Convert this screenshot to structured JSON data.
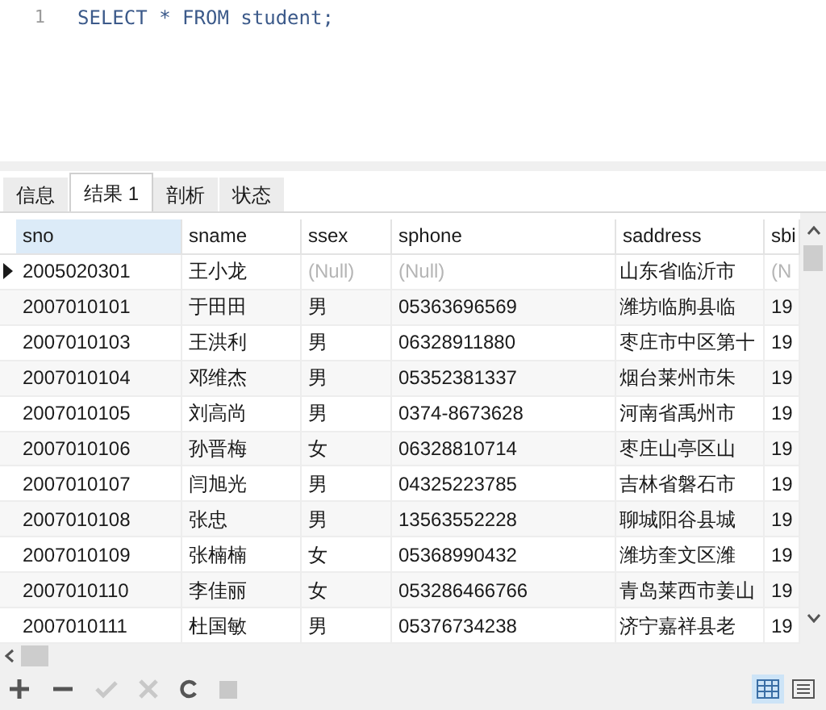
{
  "editor": {
    "lines": [
      {
        "number": "1",
        "code": "SELECT * FROM student;"
      }
    ]
  },
  "tabs": [
    {
      "label": "信息",
      "selected": false
    },
    {
      "label": "结果 1",
      "selected": true
    },
    {
      "label": "剖析",
      "selected": false
    },
    {
      "label": "状态",
      "selected": false
    }
  ],
  "table": {
    "columns": [
      {
        "label": "sno",
        "selected": true
      },
      {
        "label": "sname",
        "selected": false
      },
      {
        "label": "ssex",
        "selected": false
      },
      {
        "label": "sphone",
        "selected": false
      },
      {
        "label": "saddress",
        "selected": false
      },
      {
        "label": "sbi",
        "selected": false
      }
    ],
    "rows": [
      {
        "selected": true,
        "cells": [
          {
            "text": "2005020301",
            "null": false
          },
          {
            "text": "王小龙",
            "null": false
          },
          {
            "text": "(Null)",
            "null": true
          },
          {
            "text": "(Null)",
            "null": true
          },
          {
            "text": "山东省临沂市",
            "null": false
          },
          {
            "text": "(N",
            "null": true
          }
        ]
      },
      {
        "selected": false,
        "cells": [
          {
            "text": "2007010101",
            "null": false
          },
          {
            "text": "于田田",
            "null": false
          },
          {
            "text": "男",
            "null": false
          },
          {
            "text": "05363696569",
            "null": false
          },
          {
            "text": "潍坊临朐县临",
            "null": false
          },
          {
            "text": "19",
            "null": false
          }
        ]
      },
      {
        "selected": false,
        "cells": [
          {
            "text": "2007010103",
            "null": false
          },
          {
            "text": "王洪利",
            "null": false
          },
          {
            "text": "男",
            "null": false
          },
          {
            "text": "06328911880",
            "null": false
          },
          {
            "text": "枣庄市中区第十",
            "null": false
          },
          {
            "text": "19",
            "null": false
          }
        ]
      },
      {
        "selected": false,
        "cells": [
          {
            "text": "2007010104",
            "null": false
          },
          {
            "text": "邓维杰",
            "null": false
          },
          {
            "text": "男",
            "null": false
          },
          {
            "text": "05352381337",
            "null": false
          },
          {
            "text": "烟台莱州市朱",
            "null": false
          },
          {
            "text": "19",
            "null": false
          }
        ]
      },
      {
        "selected": false,
        "cells": [
          {
            "text": "2007010105",
            "null": false
          },
          {
            "text": "刘高尚",
            "null": false
          },
          {
            "text": "男",
            "null": false
          },
          {
            "text": "0374-8673628",
            "null": false
          },
          {
            "text": "河南省禹州市",
            "null": false
          },
          {
            "text": "19",
            "null": false
          }
        ]
      },
      {
        "selected": false,
        "cells": [
          {
            "text": "2007010106",
            "null": false
          },
          {
            "text": "孙晋梅",
            "null": false
          },
          {
            "text": "女",
            "null": false
          },
          {
            "text": "06328810714",
            "null": false
          },
          {
            "text": "枣庄山亭区山",
            "null": false
          },
          {
            "text": "19",
            "null": false
          }
        ]
      },
      {
        "selected": false,
        "cells": [
          {
            "text": "2007010107",
            "null": false
          },
          {
            "text": "闫旭光",
            "null": false
          },
          {
            "text": "男",
            "null": false
          },
          {
            "text": "04325223785",
            "null": false
          },
          {
            "text": "吉林省磐石市",
            "null": false
          },
          {
            "text": "19",
            "null": false
          }
        ]
      },
      {
        "selected": false,
        "cells": [
          {
            "text": "2007010108",
            "null": false
          },
          {
            "text": "张忠",
            "null": false
          },
          {
            "text": "男",
            "null": false
          },
          {
            "text": "13563552228",
            "null": false
          },
          {
            "text": "聊城阳谷县城",
            "null": false
          },
          {
            "text": "19",
            "null": false
          }
        ]
      },
      {
        "selected": false,
        "cells": [
          {
            "text": "2007010109",
            "null": false
          },
          {
            "text": "张楠楠",
            "null": false
          },
          {
            "text": "女",
            "null": false
          },
          {
            "text": "05368990432",
            "null": false
          },
          {
            "text": "潍坊奎文区潍",
            "null": false
          },
          {
            "text": "19",
            "null": false
          }
        ]
      },
      {
        "selected": false,
        "cells": [
          {
            "text": "2007010110",
            "null": false
          },
          {
            "text": "李佳丽",
            "null": false
          },
          {
            "text": "女",
            "null": false
          },
          {
            "text": "053286466766",
            "null": false
          },
          {
            "text": "青岛莱西市姜山",
            "null": false
          },
          {
            "text": "19",
            "null": false
          }
        ]
      },
      {
        "selected": false,
        "cells": [
          {
            "text": "2007010111",
            "null": false
          },
          {
            "text": "杜国敏",
            "null": false
          },
          {
            "text": "男",
            "null": false
          },
          {
            "text": "05376734238",
            "null": false
          },
          {
            "text": "济宁嘉祥县老",
            "null": false
          },
          {
            "text": "19",
            "null": false
          }
        ]
      }
    ]
  },
  "toolbar": [
    {
      "kind": "add",
      "disabled": false
    },
    {
      "kind": "remove",
      "disabled": false
    },
    {
      "kind": "apply",
      "disabled": true
    },
    {
      "kind": "cancel",
      "disabled": true
    },
    {
      "kind": "refresh",
      "disabled": false
    },
    {
      "kind": "stop",
      "disabled": true
    }
  ],
  "views": [
    {
      "kind": "grid",
      "selected": true
    },
    {
      "kind": "form",
      "selected": false
    }
  ]
}
